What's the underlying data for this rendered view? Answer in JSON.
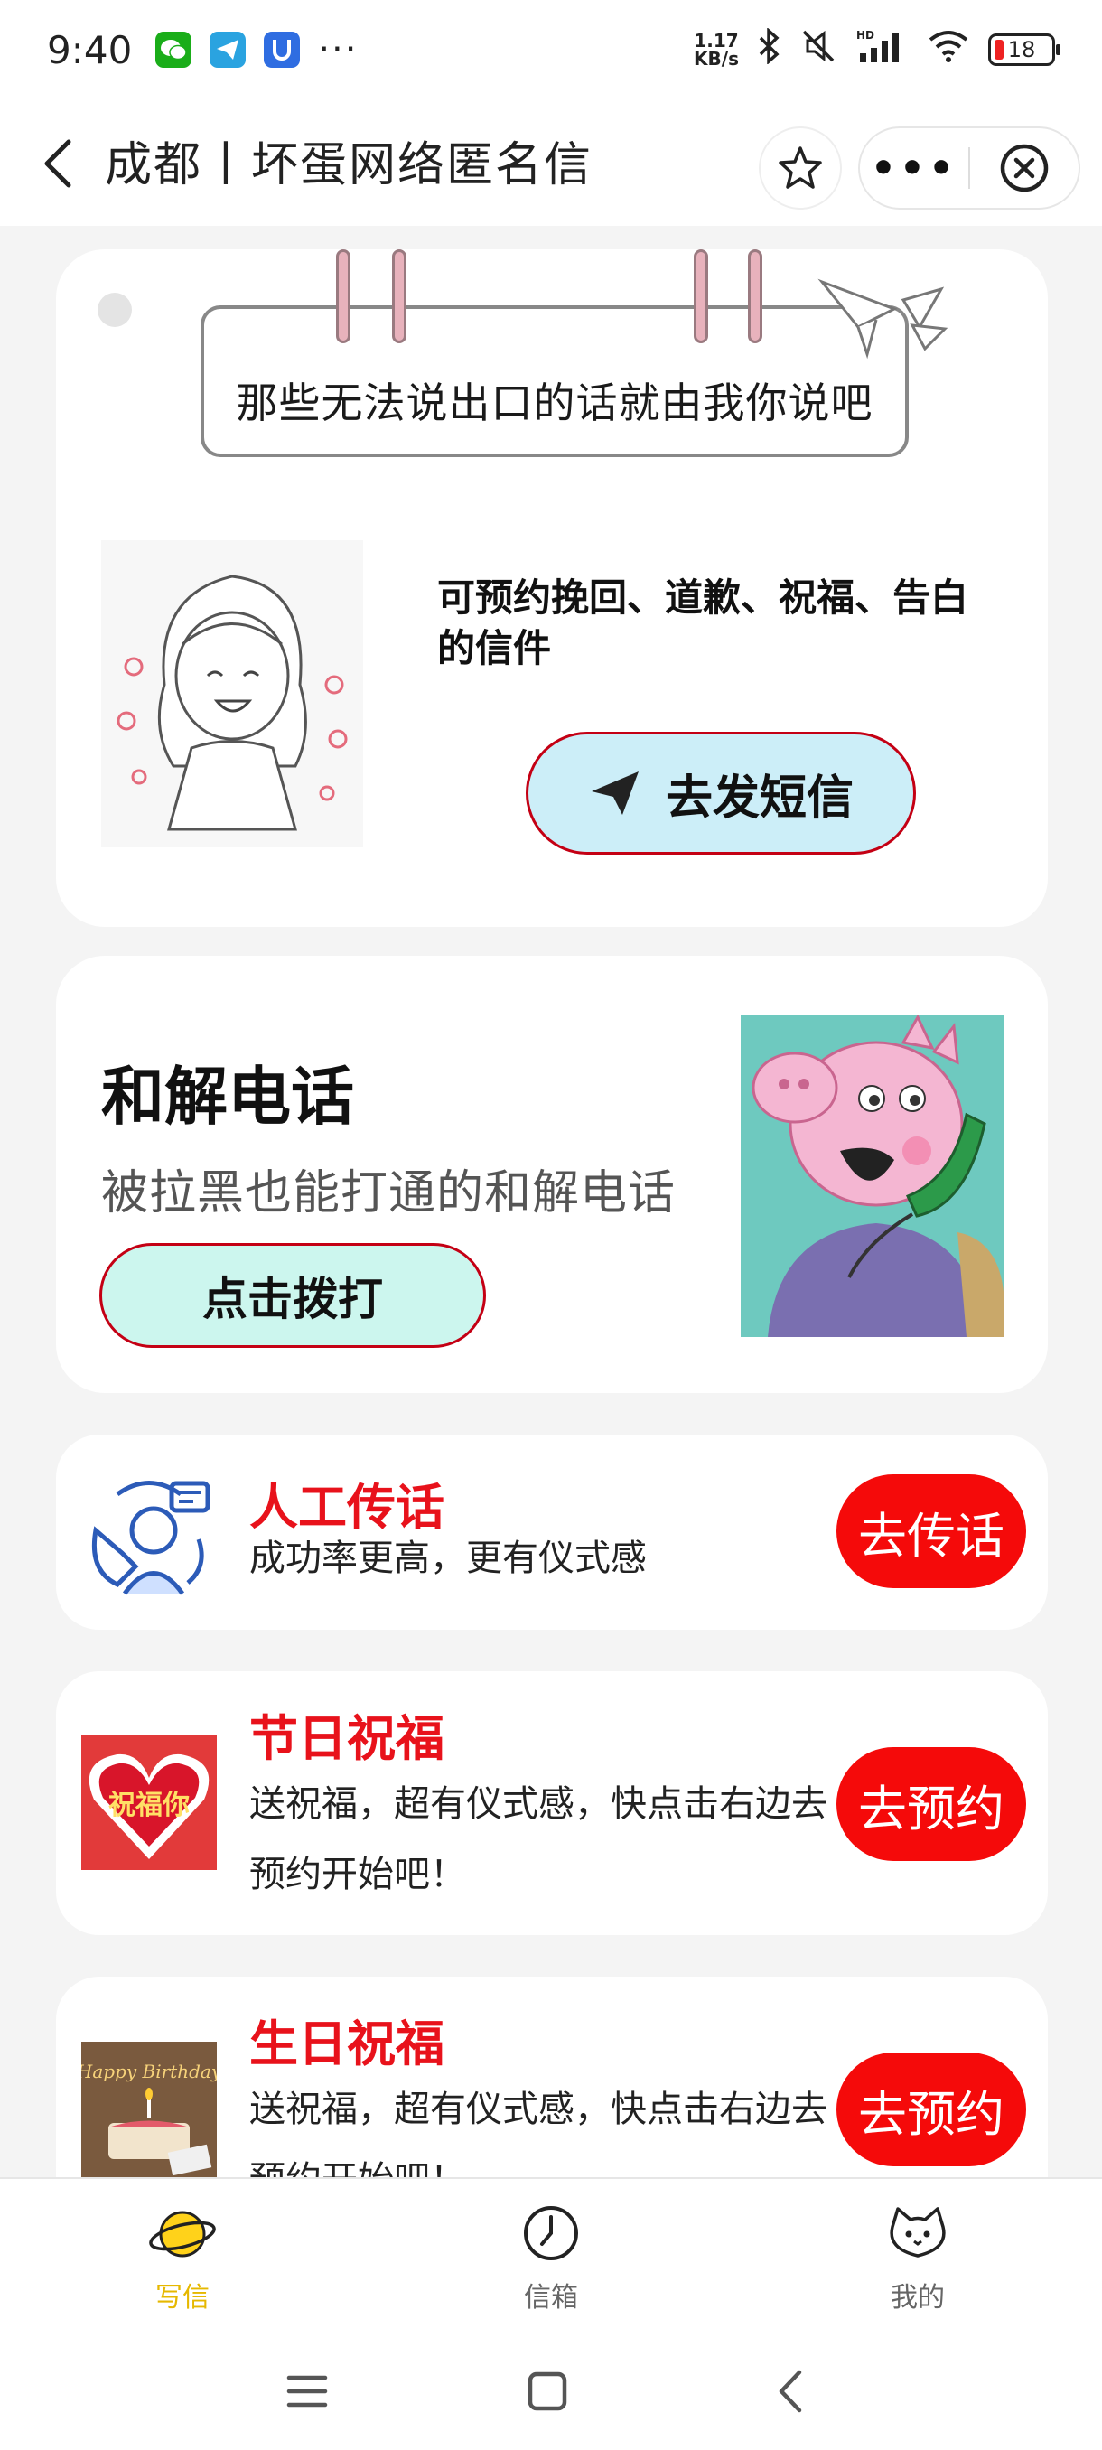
{
  "status_bar": {
    "time": "9:40",
    "net_speed_value": "1.17",
    "net_speed_unit": "KB/s",
    "battery": "18",
    "more_dots": "···",
    "hd_label": "HD"
  },
  "header": {
    "title": "成都丨坏蛋网络匿名信",
    "more_label": "•••"
  },
  "letter_card": {
    "note_text": "那些无法说出口的话就由我你说吧",
    "description": "可预约挽回、道歉、祝福、告白的信件",
    "button_label": "去发短信"
  },
  "call_card": {
    "title": "和解电话",
    "description": "被拉黑也能打通的和解电话",
    "button_label": "点击拨打"
  },
  "services": [
    {
      "title": "人工传话",
      "description": "成功率更高，更有仪式感",
      "button_label": "去传话"
    },
    {
      "title": "节日祝福",
      "description": "送祝福，超有仪式感，快点击右边去预约开始吧！",
      "button_label": "去预约",
      "icon_text": "祝福你"
    },
    {
      "title": "生日祝福",
      "description": "送祝福，超有仪式感，快点击右边去预约开始吧！",
      "button_label": "去预约",
      "icon_text": "Happy Birthday"
    }
  ],
  "tabs": [
    {
      "label": "写信",
      "icon": "planet-icon",
      "active": true
    },
    {
      "label": "信箱",
      "icon": "clock-icon",
      "active": false
    },
    {
      "label": "我的",
      "icon": "cat-icon",
      "active": false
    }
  ],
  "colors": {
    "accent_red": "#f50a0a",
    "title_red": "#e8121b",
    "active_tab": "#e6b800",
    "sms_button_bg": "#cceef8",
    "dial_button_bg": "#ccf6ee"
  }
}
